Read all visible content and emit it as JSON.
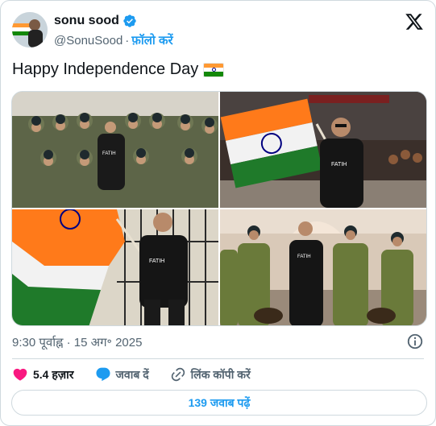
{
  "author": {
    "display_name": "sonu sood",
    "handle": "@SonuSood",
    "separator": "·",
    "follow_label": "फ़ॉलो करें",
    "verified": true
  },
  "tweet": {
    "text": "Happy Independence Day",
    "emoji": "indian-flag"
  },
  "media": {
    "photos": [
      {
        "alt": "group-photo-with-cadets",
        "shirt_text": "FATIH"
      },
      {
        "alt": "holding-flag-at-border",
        "shirt_text": "FATIH"
      },
      {
        "alt": "waving-flag",
        "shirt_text": "FATIH"
      },
      {
        "alt": "with-bsf-soldiers",
        "shirt_text": "FATIH"
      }
    ]
  },
  "meta": {
    "timestamp": "9:30 पूर्वाह्न · 15 अग॰ 2025"
  },
  "actions": {
    "like_count": "5.4 हज़ार",
    "reply_label": "जवाब दें",
    "copy_link_label": "लिंक कॉपी करें"
  },
  "replies": {
    "label": "139 जवाब पढ़ें"
  },
  "colors": {
    "accent": "#1d9bf0",
    "like": "#f91880",
    "text_secondary": "#536471",
    "border": "#cfd9de",
    "saffron": "#ff9933",
    "green": "#138808"
  }
}
